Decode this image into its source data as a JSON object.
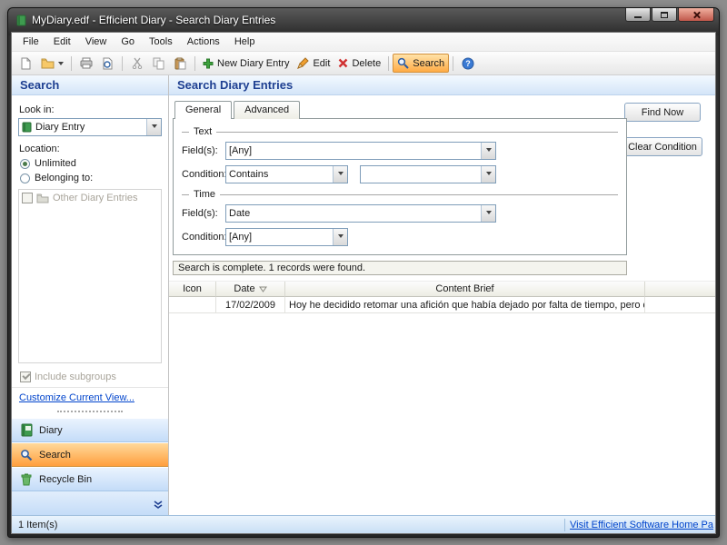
{
  "colors": {
    "accent_orange": "#FFAB45",
    "header_blue": "#1E3F91",
    "link_blue": "#0044CC"
  },
  "window": {
    "title": "MyDiary.edf - Efficient Diary - Search Diary Entries"
  },
  "menu": {
    "items": [
      "File",
      "Edit",
      "View",
      "Go",
      "Tools",
      "Actions",
      "Help"
    ]
  },
  "toolbar": {
    "new_entry_label": "New Diary Entry",
    "edit_label": "Edit",
    "delete_label": "Delete",
    "search_label": "Search"
  },
  "sidebar": {
    "title": "Search",
    "look_in_label": "Look in:",
    "look_in_value": "Diary Entry",
    "location_label": "Location:",
    "unlimited_label": "Unlimited",
    "belonging_label": "Belonging to:",
    "other_entries_label": "Other Diary Entries",
    "include_subgroups_label": "Include subgroups",
    "customize_link": "Customize Current View...",
    "nav": [
      {
        "label": "Diary"
      },
      {
        "label": "Search"
      },
      {
        "label": "Recycle Bin"
      }
    ]
  },
  "main": {
    "title": "Search Diary Entries",
    "tabs": [
      {
        "label": "General"
      },
      {
        "label": "Advanced"
      }
    ],
    "text_group": {
      "title": "Text",
      "fields_label": "Field(s):",
      "fields_value": "[Any]",
      "condition_label": "Condition:",
      "condition_value": "Contains",
      "condition_value2": ""
    },
    "time_group": {
      "title": "Time",
      "fields_label": "Field(s):",
      "fields_value": "Date",
      "condition_label": "Condition:",
      "condition_value": "[Any]"
    },
    "find_now_label": "Find Now",
    "clear_condition_label": "Clear Condition",
    "status_message": "Search is complete. 1 records were found.",
    "results": {
      "columns": [
        "Icon",
        "Date",
        "Content Brief"
      ],
      "rows": [
        {
          "date": "17/02/2009",
          "content": "Hoy he decidido retomar una afición que había dejado por falta de tiempo, pero que"
        }
      ]
    }
  },
  "statusbar": {
    "items_count": "1 Item(s)",
    "home_link": "Visit Efficient Software Home Pa"
  }
}
